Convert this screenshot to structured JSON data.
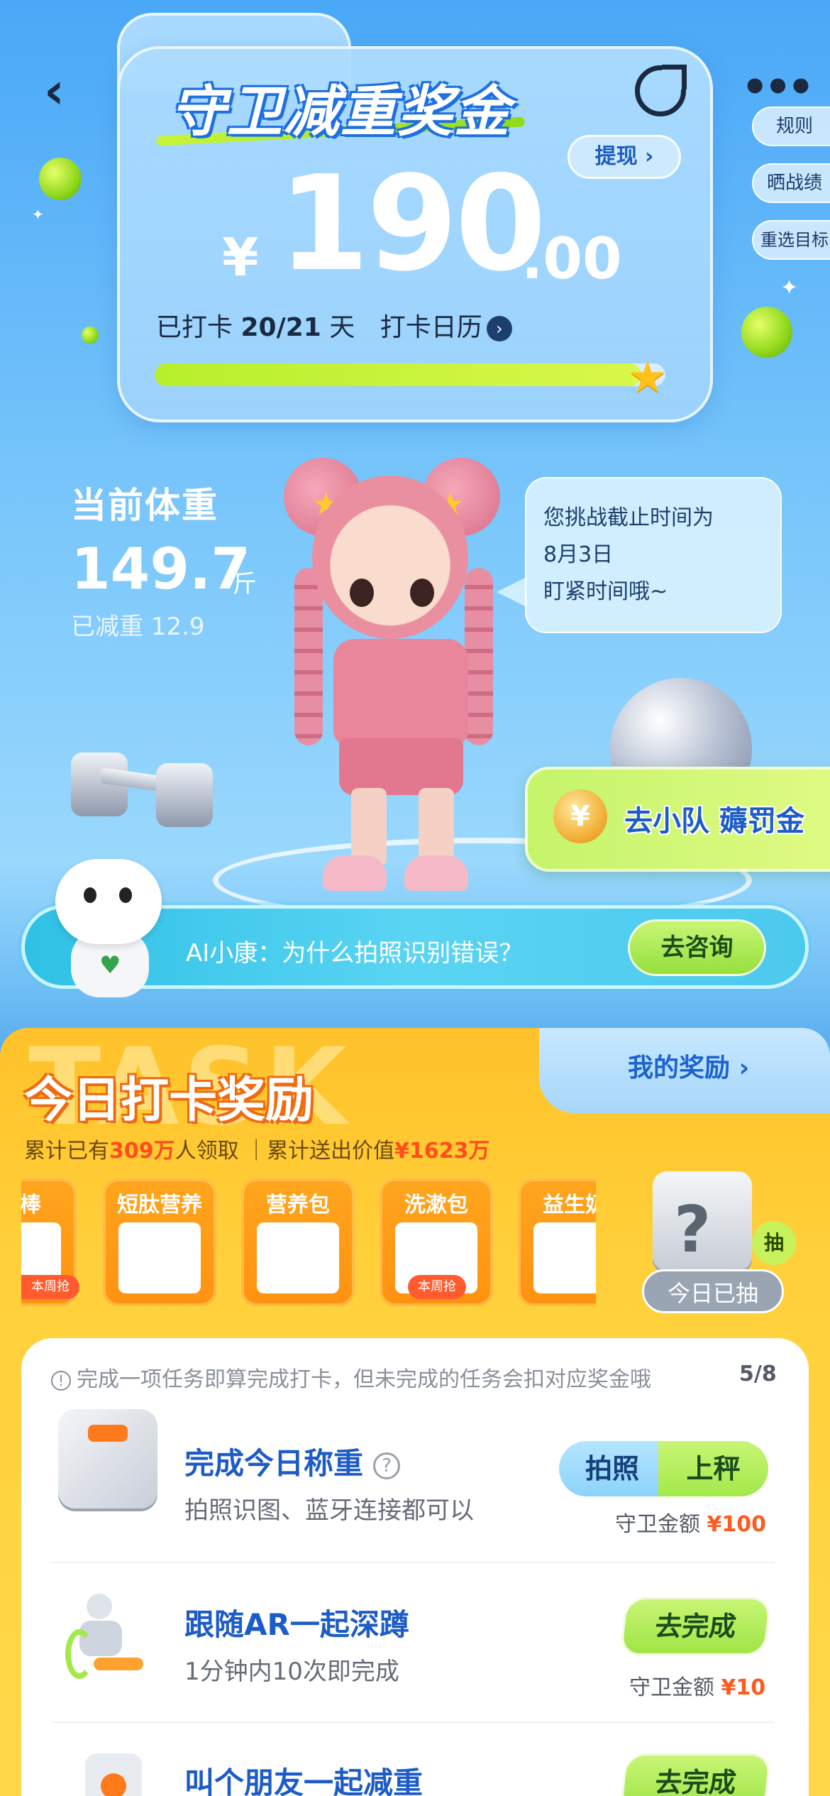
{
  "header": {
    "title": "守卫减重奖金",
    "side_menu": [
      "规则",
      "晒战绩",
      "重选目标"
    ],
    "withdraw_label": "提现 ›",
    "amount": {
      "currency": "¥",
      "integer": "190",
      "decimal": ".00"
    },
    "checkin": {
      "prefix": "已打卡",
      "progress_text": "20/21",
      "unit": "天",
      "calendar_label": "打卡日历",
      "days_done": 20,
      "days_total": 21
    }
  },
  "weight": {
    "label": "当前体重",
    "value": "149.7",
    "unit": "斤",
    "lost_text": "已减重 12.9"
  },
  "speech_bubble": [
    "您挑战截止时间为",
    "8月3日",
    "盯紧时间哦~"
  ],
  "team_button": {
    "label": "去小队 薅罚金",
    "coin_symbol": "¥"
  },
  "ai_bar": {
    "question": "AI小康：为什么拍照识别错误？",
    "button_label": "去咨询"
  },
  "task_panel": {
    "watermark": "TASK",
    "title": "今日打卡奖励",
    "my_reward_label": "我的奖励 ›",
    "stats": {
      "prefix": "累计已有",
      "people": "309万",
      "mid": "人领取 ｜累计送出价值",
      "value": "¥1623万"
    },
    "rewards": [
      {
        "label": "拿棒",
        "badge": "本周抢"
      },
      {
        "label": "短肽营养",
        "badge": ""
      },
      {
        "label": "营养包",
        "badge": ""
      },
      {
        "label": "洗漱包",
        "badge": "本周抢"
      },
      {
        "label": "益生奶",
        "badge": ""
      }
    ],
    "mystery": {
      "symbol": "?",
      "badge": "抽",
      "status": "今日已抽"
    }
  },
  "tasks": {
    "notice": "完成一项任务即算完成打卡，但未完成的任务会扣对应奖金哦",
    "notice_count": "5/8",
    "items": [
      {
        "title": "完成今日称重",
        "desc": "拍照识图、蓝牙连接都可以",
        "reward_label": "守卫金额",
        "reward_amount": "¥100",
        "buttons": [
          "拍照",
          "上秤"
        ]
      },
      {
        "title": "跟随AR一起深蹲",
        "desc": "1分钟内10次即完成",
        "reward_label": "守卫金额",
        "reward_amount": "¥10",
        "buttons": [
          "去完成"
        ]
      },
      {
        "title": "叫个朋友一起减重",
        "desc": "",
        "reward_label": "",
        "reward_amount": "",
        "buttons": [
          "去完成"
        ]
      }
    ]
  },
  "colors": {
    "primary_blue": "#1d5cc7",
    "accent_green": "#a4e84a",
    "panel_yellow": "#ffd03a",
    "highlight_orange": "#ff5a1f"
  }
}
